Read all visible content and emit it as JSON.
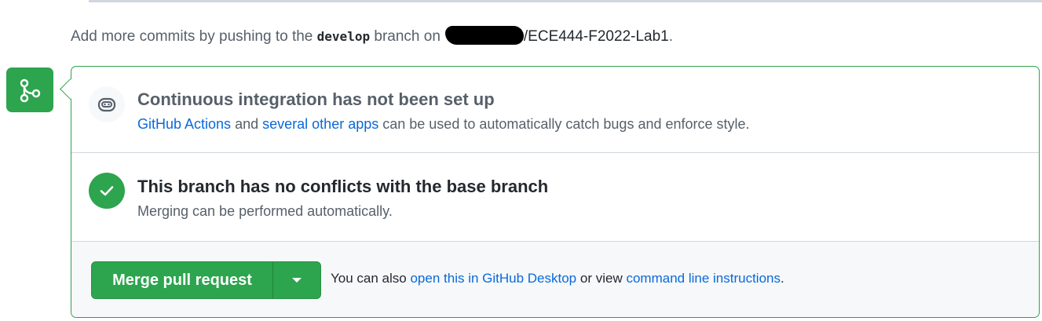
{
  "hint": {
    "prefix": "Add more commits by pushing to the",
    "branch": "develop",
    "middle": "branch on",
    "repo": "/ECE444-F2022-Lab1",
    "suffix": "."
  },
  "ci": {
    "title": "Continuous integration has not been set up",
    "link1": "GitHub Actions",
    "and": "and",
    "link2": "several other apps",
    "rest": "can be used to automatically catch bugs and enforce style."
  },
  "conflicts": {
    "title": "This branch has no conflicts with the base branch",
    "desc": "Merging can be performed automatically."
  },
  "merge": {
    "button_label": "Merge pull request",
    "also_prefix": "You can also",
    "desktop_link": "open this in GitHub Desktop",
    "or_view": "or view",
    "cli_link": "command line instructions",
    "period": "."
  },
  "colors": {
    "accent_green": "#2da44e",
    "link_blue": "#0969da",
    "muted_text": "#57606a"
  },
  "icons": {
    "merge": "git-merge-icon",
    "ci": "ci-robot-icon",
    "check": "check-circle-icon",
    "caret": "triangle-down-icon"
  }
}
